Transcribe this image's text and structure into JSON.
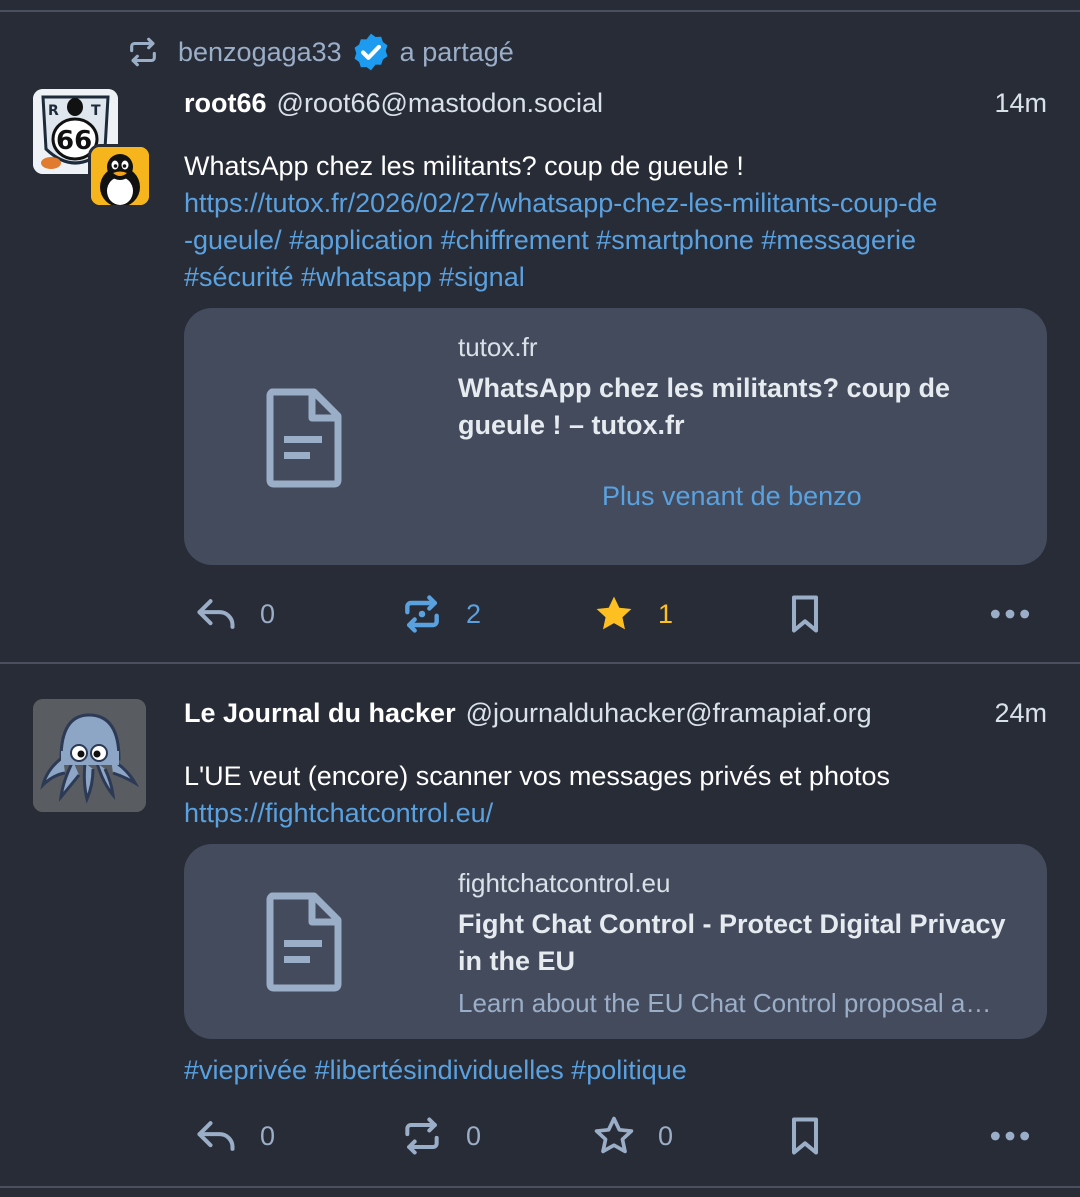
{
  "boost": {
    "user": "benzogaga33",
    "action": "a partagé"
  },
  "posts": [
    {
      "name": "root66",
      "handle": "@root66@mastodon.social",
      "time": "14m",
      "text": "WhatsApp chez les militants? coup de gueule !",
      "link_line1": "https://tutox.fr/2026/02/27/whatsapp-chez-les-militants-coup-de",
      "link_line2_url": "-gueule/",
      "tags_line2": "#application #chiffrement #smartphone #messagerie",
      "tags_line3": "#sécurité #whatsapp #signal",
      "card": {
        "domain": "tutox.fr",
        "title": "WhatsApp chez les militants? coup de gueule ! – tutox.fr",
        "more": "Plus venant de benzo"
      },
      "replies": "0",
      "boosts": "2",
      "favs": "1"
    },
    {
      "name": "Le Journal du hacker",
      "handle": "@journalduhacker@framapiaf.org",
      "time": "24m",
      "text": "L'UE veut (encore) scanner vos messages privés et photos",
      "link": "https://fightchatcontrol.eu/",
      "card": {
        "domain": "fightchatcontrol.eu",
        "title": "Fight Chat Control - Protect Digital Privacy in the EU",
        "description": "Learn about the EU Chat Control proposal and its threat to privacy"
      },
      "tags": "#vieprivée #libertésindividuelles #politique",
      "replies": "0",
      "boosts": "0",
      "favs": "0"
    }
  ],
  "colors": {
    "background": "#282c37",
    "card": "#444b5d",
    "link": "#5aa1e0",
    "muted": "#9baec8",
    "favorite": "#fdc020",
    "verified": "#1d9bf0"
  }
}
